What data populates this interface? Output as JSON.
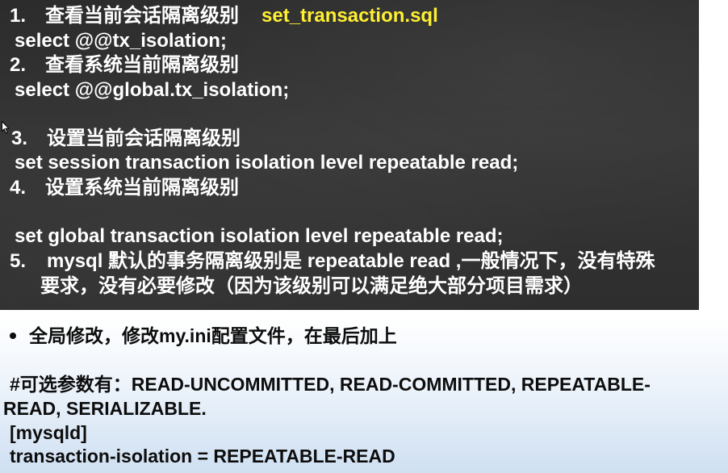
{
  "dark_panel": {
    "item1": {
      "number": "1.",
      "text": "查看当前会话隔离级别",
      "file": "set_transaction.sql"
    },
    "item1_code": "select @@tx_isolation;",
    "item2": {
      "number": "2.",
      "text": "查看系统当前隔离级别"
    },
    "item2_code": "select @@global.tx_isolation;",
    "item3": {
      "number": "3.",
      "text": "设置当前会话隔离级别"
    },
    "item3_code": "set session transaction isolation level repeatable read;",
    "item4": {
      "number": "4.",
      "text": "设置系统当前隔离级别"
    },
    "item4_code": "set global transaction isolation level repeatable read;",
    "item5": {
      "number": "5.",
      "text_line1": "mysql 默认的事务隔离级别是 repeatable read ,一般情况下，没有特殊",
      "text_line2": "要求，没有必要修改（因为该级别可以满足绝大部分项目需求）"
    }
  },
  "light_panel": {
    "bullet_text": "全局修改，修改my.ini配置文件，在最后加上",
    "options_line1": "#可选参数有：READ-UNCOMMITTED, READ-COMMITTED, REPEATABLE-",
    "options_line2": "READ, SERIALIZABLE.",
    "section_header": "[mysqld]",
    "config_line": "transaction-isolation = REPEATABLE-READ"
  },
  "colors": {
    "dark_background": "#2f2f2f",
    "dark_text": "#ffffff",
    "highlight_yellow": "#ffef32",
    "light_background": "#dce8f5",
    "light_text": "#0d0d0d"
  }
}
